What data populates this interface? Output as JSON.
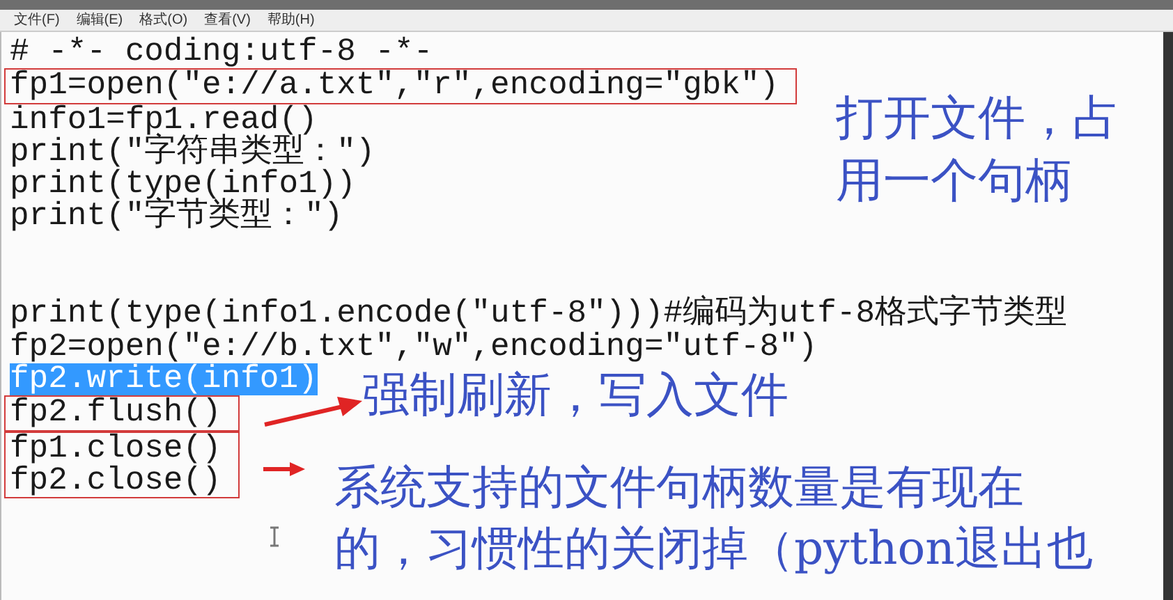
{
  "menu": [
    {
      "label": "文件(F)"
    },
    {
      "label": "编辑(E)"
    },
    {
      "label": "格式(O)"
    },
    {
      "label": "查看(V)"
    },
    {
      "label": "帮助(H)"
    }
  ],
  "code": [
    {
      "kind": "plain",
      "lines": [
        {
          "kind": "code",
          "text": "# -*- coding:utf-8 -*-",
          "selected": false
        }
      ]
    },
    {
      "kind": "boxed",
      "lines": [
        {
          "kind": "code",
          "text": "fp1=open(\"e://a.txt\",\"r\",encoding=\"gbk\")",
          "selected": false
        }
      ]
    },
    {
      "kind": "plain",
      "lines": [
        {
          "kind": "code",
          "text": "info1=fp1.read()",
          "selected": false
        },
        {
          "kind": "code",
          "text": "print(\"字符串类型：\")",
          "selected": false
        },
        {
          "kind": "code",
          "text": "print(type(info1))",
          "selected": false
        },
        {
          "kind": "code",
          "text": "print(\"字节类型：\")",
          "selected": false
        },
        {
          "kind": "blank"
        },
        {
          "kind": "blank"
        },
        {
          "kind": "code",
          "text": "print(type(info1.encode(\"utf-8\")))#编码为utf-8格式字节类型",
          "selected": false
        },
        {
          "kind": "code",
          "text": "fp2=open(\"e://b.txt\",\"w\",encoding=\"utf-8\")",
          "selected": false
        },
        {
          "kind": "code",
          "text": "fp2.write(info1)",
          "selected": true
        }
      ]
    },
    {
      "kind": "boxed",
      "lines": [
        {
          "kind": "code",
          "text": "fp2.flush()",
          "selected": false
        }
      ]
    },
    {
      "kind": "boxed",
      "lines": [
        {
          "kind": "code",
          "text": "fp1.close()",
          "selected": false
        },
        {
          "kind": "code",
          "text": "fp2.close()",
          "selected": false
        }
      ]
    }
  ],
  "annotations": [
    {
      "kind": "note",
      "text": "打开文件，占用一个句柄"
    },
    {
      "kind": "arrow_note",
      "text": "强制刷新，写入文件"
    },
    {
      "kind": "arrow_note",
      "text": "系统支持的文件句柄数量是有现在的，习惯性的关闭掉（python退出也"
    }
  ]
}
